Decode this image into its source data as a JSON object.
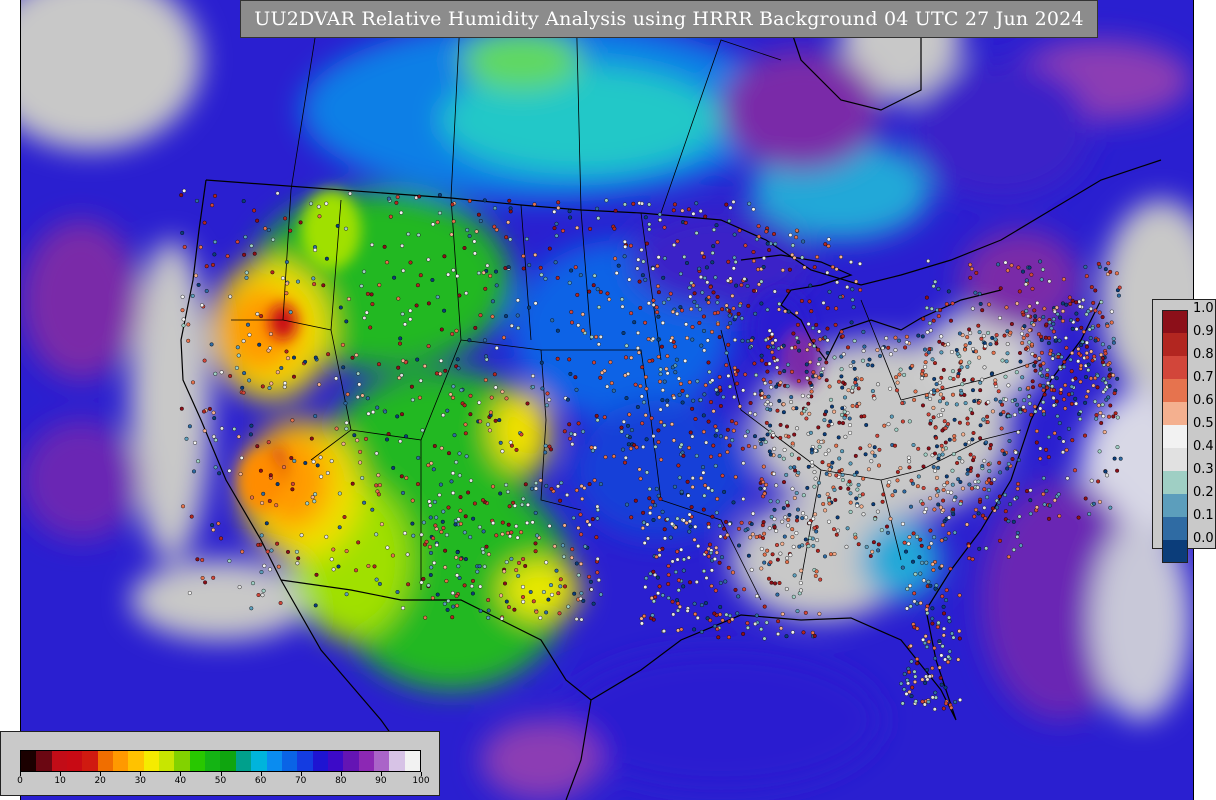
{
  "title": "UU2DVAR Relative Humidity Analysis using HRRR Background 04 UTC 27 Jun 2024",
  "colors": {
    "land_nodata": "#c8c8c8",
    "ocean_moist": "#2a1fd0",
    "very_moist": "#7a2aa8",
    "moist": "#0f7fe6",
    "mid": "#24c8c8",
    "green": "#22b822",
    "yellow": "#f0e000",
    "orange": "#ff9a00",
    "red": "#c80a14",
    "border": "#000000"
  },
  "ob_legend": {
    "labels": [
      "1.0",
      "0.9",
      "0.8",
      "0.7",
      "0.6",
      "0.5",
      "0.4",
      "0.3",
      "0.2",
      "0.1",
      "0.0"
    ],
    "colors": [
      "#8c0f19",
      "#b22620",
      "#d2463a",
      "#e6734e",
      "#f4b08f",
      "#f2f2f2",
      "#e1e1e1",
      "#9fcfc4",
      "#5c9ebc",
      "#2f6ba3",
      "#0b3d7a"
    ]
  },
  "colorbar": {
    "ticks": [
      "0",
      "10",
      "20",
      "30",
      "40",
      "50",
      "60",
      "70",
      "80",
      "90",
      "100"
    ],
    "colors": [
      "#1b0000",
      "#6b0712",
      "#c20c17",
      "#c80a14",
      "#d01a10",
      "#f06e00",
      "#ff9900",
      "#ffc200",
      "#f5eb00",
      "#c8e600",
      "#82d200",
      "#28c800",
      "#14b414",
      "#0fa50f",
      "#00a08c",
      "#00b4dc",
      "#0a8cf0",
      "#0a64e6",
      "#143ce1",
      "#1e14d2",
      "#3c0ac8",
      "#6414b4",
      "#8c28b4",
      "#aa64c8",
      "#d7c3e6",
      "#f2f2f2"
    ]
  }
}
